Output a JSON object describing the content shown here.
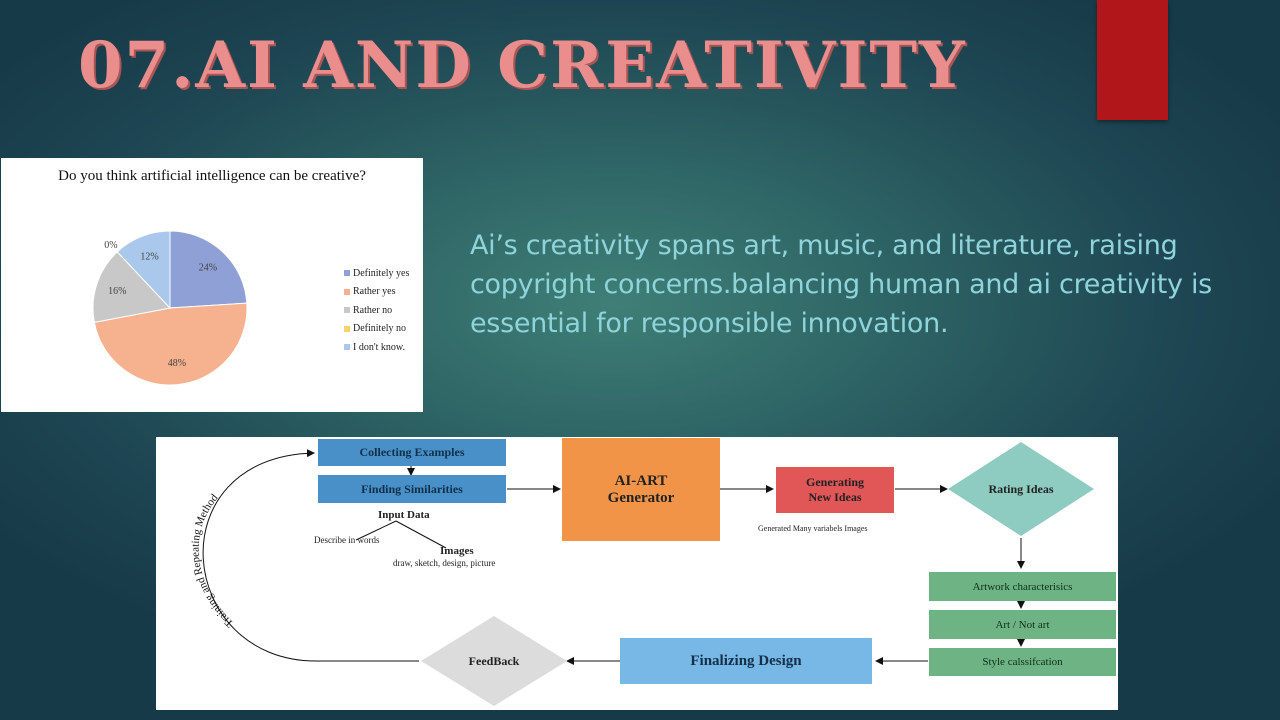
{
  "slide": {
    "title": "07.AI AND CREATIVITY",
    "body_text": "Ai’s creativity spans art, music, and literature, raising copyright concerns.balancing human and ai creativity is essential for responsible innovation.",
    "colors": {
      "title": "#e98d8d",
      "accent_bar": "#b1171a",
      "body_text": "#8fd4db"
    }
  },
  "chart_data": {
    "type": "pie",
    "title": "Do you think artificial intelligence can be creative?",
    "labels": [
      "Definitely yes",
      "Rather yes",
      "Rather no",
      "Definitely no",
      "I don't know."
    ],
    "values": [
      24,
      48,
      16,
      0,
      12
    ],
    "value_labels": [
      "24%",
      "48%",
      "16%",
      "0%",
      "12%"
    ],
    "colors": [
      "#8ea0d6",
      "#f6b18e",
      "#c8c8c8",
      "#f7d36b",
      "#a9c8ec"
    ],
    "legend_position": "right"
  },
  "diagram": {
    "collecting_examples": "Collecting Examples",
    "finding_similarities": "Finding Similarities",
    "input_data": "Input Data",
    "describe_in_words": "Describe in words",
    "images": "Images",
    "images_detail": "draw, sketch, design, picture",
    "ai_art_line1": "AI-ART",
    "ai_art_line2": "Generator",
    "generating_line1": "Generating",
    "generating_line2": "New Ideas",
    "generated_note": "Generated Many variabels Images",
    "rating_ideas": "Rating Ideas",
    "artwork_characteristics": "Artwork characterisics",
    "art_not_art": "Art / Not art",
    "style_classification": "Style calssifcation",
    "finalizing_design": "Finalizing Design",
    "feedback": "FeedBack",
    "loop_label": "Training and Repeating Method"
  }
}
